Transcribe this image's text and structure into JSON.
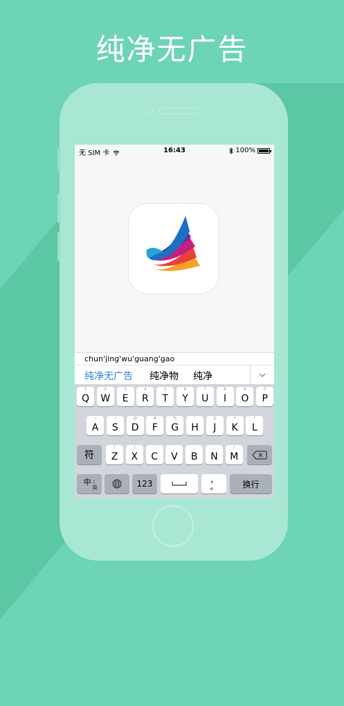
{
  "headline": "纯净无广告",
  "status_bar": {
    "carrier": "无 SIM 卡",
    "wifi_icon": "wifi-icon",
    "time": "16:43",
    "bluetooth_icon": "bluetooth-icon",
    "battery_percent": "100%"
  },
  "app_icon": "feather-logo-icon",
  "keyboard": {
    "pinyin_input": "chun'jing'wu'guang'gao",
    "candidates": [
      "纯净无广告",
      "纯净物",
      "纯净"
    ],
    "expand_icon": "chevron-down-icon",
    "row1": [
      {
        "hint": "1",
        "key": "Q"
      },
      {
        "hint": "2",
        "key": "W"
      },
      {
        "hint": "3",
        "key": "E"
      },
      {
        "hint": "4",
        "key": "R"
      },
      {
        "hint": "5",
        "key": "T"
      },
      {
        "hint": "6",
        "key": "Y"
      },
      {
        "hint": "7",
        "key": "U"
      },
      {
        "hint": "8",
        "key": "I"
      },
      {
        "hint": "9",
        "key": "O"
      },
      {
        "hint": "0",
        "key": "P"
      }
    ],
    "row2": [
      {
        "hint": "~",
        "key": "A"
      },
      {
        "hint": "!",
        "key": "S"
      },
      {
        "hint": "@",
        "key": "D"
      },
      {
        "hint": "#",
        "key": "F"
      },
      {
        "hint": "%",
        "key": "G"
      },
      {
        "hint": "'",
        "key": "H"
      },
      {
        "hint": "&",
        "key": "J"
      },
      {
        "hint": "*",
        "key": "K"
      },
      {
        "hint": "?",
        "key": "L"
      }
    ],
    "row3": [
      {
        "hint": "(",
        "key": "Z"
      },
      {
        "hint": ")",
        "key": "X"
      },
      {
        "hint": "-",
        "key": "C"
      },
      {
        "hint": "_",
        "key": "V"
      },
      {
        "hint": ":",
        "key": "B"
      },
      {
        "hint": ";",
        "key": "N"
      },
      {
        "hint": "/",
        "key": "M"
      }
    ],
    "symbol_key": "符",
    "delete_icon": "backspace-icon",
    "lang_key_main": "中",
    "lang_key_sub": "英",
    "globe_icon": "globe-icon",
    "numeric_key": "123",
    "space_icon": "space-bar-icon",
    "punct_key_top": "，",
    "punct_key_bottom": "。",
    "return_key": "换行"
  },
  "colors": {
    "background": "#6dd4b5",
    "phone_body": "#a9e7d5",
    "candidate_highlight": "#2d7fd8"
  }
}
